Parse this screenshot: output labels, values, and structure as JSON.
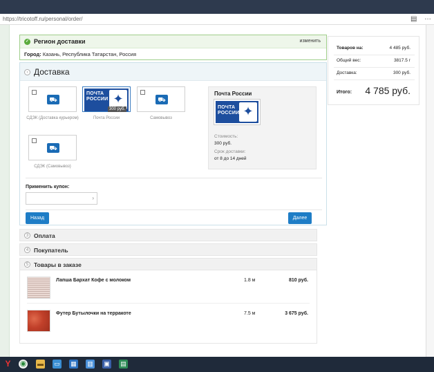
{
  "browser": {
    "url": "https://tricotoff.ru/personal/order/",
    "reader_icon": "page-icon",
    "menu_icon": "ellipsis-icon"
  },
  "region": {
    "title": "Регион доставки",
    "edit_label": "изменить",
    "city_label": "Город:",
    "city_value": "Казань, Республика Татарстан, Россия"
  },
  "delivery": {
    "title": "Доставка",
    "options": [
      {
        "label": "СДЭК (Доставка курьером)",
        "checked": false
      },
      {
        "label": "Почта России",
        "checked": true,
        "price_badge": "300 руб."
      },
      {
        "label": "Самовывоз",
        "checked": false
      },
      {
        "label": "СДЭК (Самовывоз)",
        "checked": false
      }
    ],
    "logo_text_1": "ПОЧТА",
    "logo_text_2": "РОССИИ",
    "info": {
      "title": "Почта России",
      "cost_label": "Стоимость:",
      "cost_value": "300 руб.",
      "time_label": "Срок доставки:",
      "time_value": "от 8 до 14 дней"
    },
    "coupon_label": "Применить купон:",
    "back_label": "Назад",
    "next_label": "Далее"
  },
  "sections": [
    {
      "num": "3",
      "title": "Оплата"
    },
    {
      "num": "4",
      "title": "Покупатель"
    },
    {
      "num": "5",
      "title": "Товары в заказе"
    }
  ],
  "items": [
    {
      "name": "Лапша Бархат Кофе с молоком",
      "qty": "1.8 м",
      "price": "810 руб."
    },
    {
      "name": "Футер Бутылочки на терракоте",
      "qty": "7.5 м",
      "price": "3 675 руб."
    }
  ],
  "summary": {
    "goods_label": "Товаров на:",
    "goods_value": "4 485 руб.",
    "weight_label": "Общий вес:",
    "weight_value": "3817.5 г",
    "delivery_label": "Доставка:",
    "delivery_value": "300 руб.",
    "total_label": "Итого:",
    "total_value": "4 785 руб."
  },
  "taskbar": [
    "yandex-browser-icon",
    "chrome-icon",
    "file-explorer-icon",
    "monitor-icon",
    "calculator-icon",
    "calendar-icon",
    "save-icon",
    "terminal-icon"
  ]
}
